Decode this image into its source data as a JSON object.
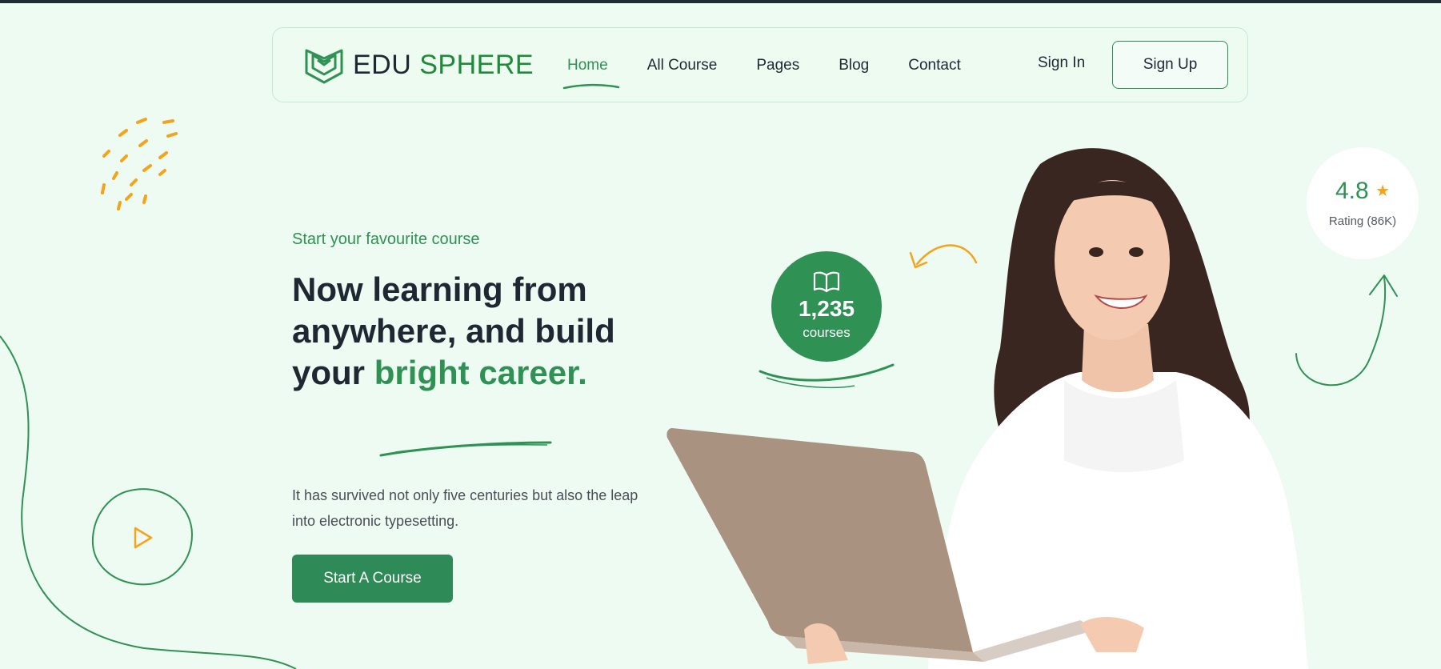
{
  "brand": {
    "name_part1": "EDU",
    "name_part2": "SPHERE",
    "logo_icon": "book-shield-icon",
    "primary_color": "#2e8b57",
    "accent_color": "#f5a31a"
  },
  "nav": {
    "items": [
      {
        "label": "Home",
        "active": true
      },
      {
        "label": "All Course",
        "active": false
      },
      {
        "label": "Pages",
        "active": false
      },
      {
        "label": "Blog",
        "active": false
      },
      {
        "label": "Contact",
        "active": false
      }
    ],
    "sign_in": "Sign In",
    "sign_up": "Sign Up"
  },
  "hero": {
    "eyebrow": "Start your favourite course",
    "headline_plain": "Now learning from anywhere, and build your ",
    "headline_highlight": "bright career.",
    "description": "It has survived not only five centuries but also the leap into electronic typesetting.",
    "cta": "Start A Course",
    "play_icon": "play-icon"
  },
  "stats": {
    "courses_count": "1,235",
    "courses_label": "courses",
    "courses_icon": "open-book-icon",
    "rating_value": "4.8",
    "rating_star": "★",
    "rating_label": "Rating (86K)"
  }
}
